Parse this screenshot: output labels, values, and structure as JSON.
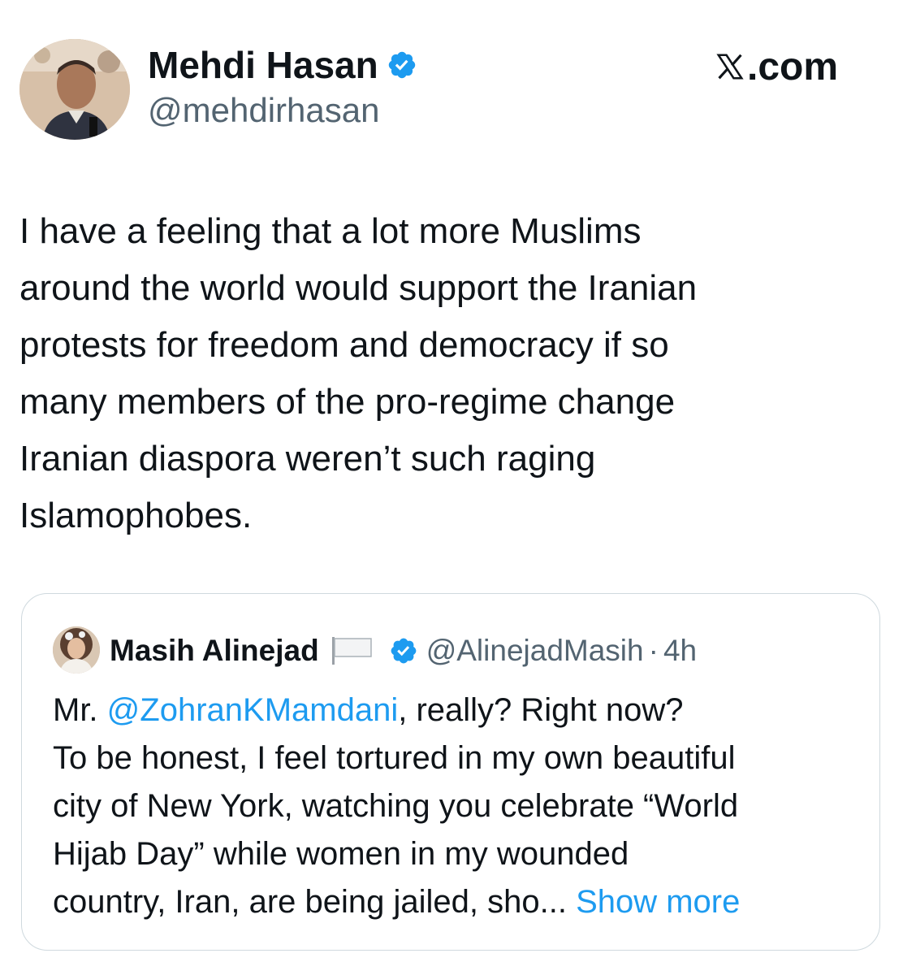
{
  "tweet": {
    "author": {
      "name": "Mehdi Hasan",
      "handle": "@mehdirhasan",
      "verified": true,
      "avatar_icon": "profile-photo"
    },
    "brand": ".com",
    "brand_icon": "x-logo-icon",
    "text_lines": [
      "I have a feeling that a lot more Muslims",
      "around the world would support the Iranian",
      "protests for freedom and democracy if so",
      "many members of the pro-regime change",
      "Iranian diaspora weren’t such raging",
      "Islamophobes."
    ]
  },
  "quoted_tweet": {
    "author": {
      "name": "Masih Alinejad",
      "handle": "@AlinejadMasih",
      "separator": "·",
      "time": "4h",
      "flag_icon": "white-flag-icon",
      "verified": true
    },
    "text": {
      "line1_prefix": "Mr. ",
      "mention": "@ZohranKMamdani",
      "line1_suffix": ", really? Right now?",
      "lines": [
        "To be honest, I feel tortured in my own beautiful",
        "city of New York, watching you celebrate “World",
        "Hijab Day” while women in my wounded"
      ],
      "last_line": "country, Iran, are being jailed, sho",
      "ellipsis": "...",
      "show_more": " Show more"
    }
  },
  "colors": {
    "accent": "#1d9bf0",
    "text": "#0f1419",
    "secondary": "#536471",
    "border": "#cfd9de"
  }
}
